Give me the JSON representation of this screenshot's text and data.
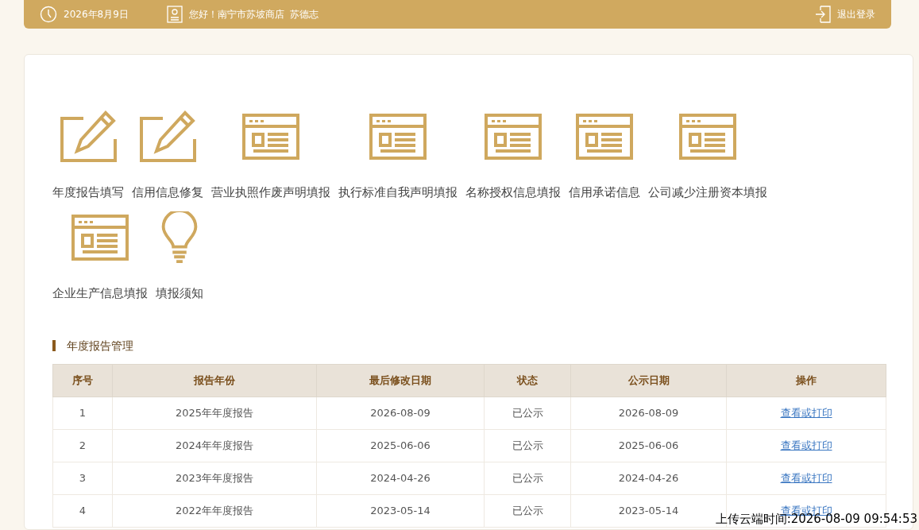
{
  "top_bar": {
    "date": "2026年8月9日",
    "greeting": "您好！南宁市苏坡商店  苏德志",
    "logout": "退出登录"
  },
  "shortcuts": [
    {
      "kind": "edit",
      "label": "年度报告填写"
    },
    {
      "kind": "edit",
      "label": "信用信息修复"
    },
    {
      "kind": "form",
      "label": "营业执照作废声明填报"
    },
    {
      "kind": "form",
      "label": "执行标准自我声明填报"
    },
    {
      "kind": "form",
      "label": "名称授权信息填报"
    },
    {
      "kind": "form",
      "label": "信用承诺信息"
    },
    {
      "kind": "form",
      "label": "公司减少注册资本填报"
    },
    {
      "kind": "form",
      "label": "企业生产信息填报"
    },
    {
      "kind": "bulb",
      "label": "填报须知"
    }
  ],
  "section_title": "年度报告管理",
  "table": {
    "columns": [
      "序号",
      "报告年份",
      "最后修改日期",
      "状态",
      "公示日期",
      "操作"
    ],
    "rows": [
      [
        "1",
        "2025年年度报告",
        "2026-08-09",
        "已公示",
        "2026-08-09",
        "查看或打印"
      ],
      [
        "2",
        "2024年年度报告",
        "2025-06-06",
        "已公示",
        "2025-06-06",
        "查看或打印"
      ],
      [
        "3",
        "2023年年度报告",
        "2024-04-26",
        "已公示",
        "2024-04-26",
        "查看或打印"
      ],
      [
        "4",
        "2022年年度报告",
        "2023-05-14",
        "已公示",
        "2023-05-14",
        "查看或打印"
      ]
    ]
  },
  "upload_stamp": "上传云端时间:2026-08-09 09:54:53"
}
